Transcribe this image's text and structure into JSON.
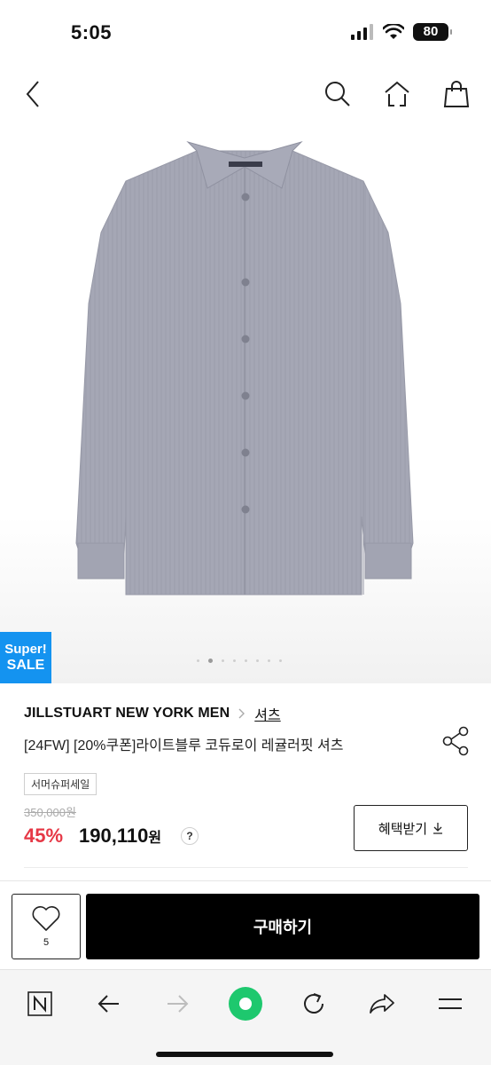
{
  "status": {
    "time": "5:05",
    "battery": "80"
  },
  "nav": {
    "back_icon": "chevron-left-icon",
    "search_icon": "search-icon",
    "home_icon": "home-icon",
    "cart_icon": "shopping-bag-icon"
  },
  "image": {
    "badge_line1": "Super!",
    "badge_line2": "SALE",
    "page_count": 8,
    "current_page": 2
  },
  "product": {
    "brand": "JILLSTUART NEW YORK MEN",
    "category": "셔츠",
    "title": "[24FW] [20%쿠폰]라이트블루 코듀로이 레귤러핏 셔츠",
    "tag": "서머슈퍼세일",
    "original_price": "350,000원",
    "discount": "45%",
    "price": "190,110",
    "currency": "원",
    "help": "?",
    "benefit_label": "혜택받기"
  },
  "purchase": {
    "like_count": "5",
    "buy_label": "구매하기"
  },
  "colors": {
    "discount": "#e63846",
    "badge": "#1493f0",
    "shirt": "#a4a6b4",
    "browser_accent": "#1ec86e"
  }
}
